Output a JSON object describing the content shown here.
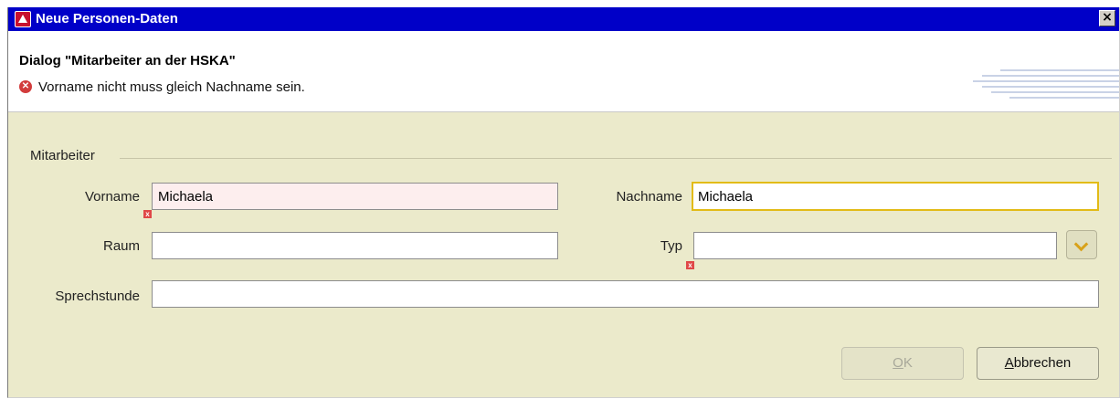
{
  "window": {
    "title": "Neue Personen-Daten"
  },
  "header": {
    "dialog_title": "Dialog \"Mitarbeiter an der HSKA\"",
    "error_message": "Vorname nicht muss gleich Nachname sein."
  },
  "form": {
    "section_label": "Mitarbeiter",
    "vorname": {
      "label": "Vorname",
      "value": "Michaela"
    },
    "nachname": {
      "label": "Nachname",
      "value": "Michaela"
    },
    "raum": {
      "label": "Raum",
      "value": ""
    },
    "typ": {
      "label": "Typ",
      "value": ""
    },
    "sprechstunde": {
      "label": "Sprechstunde",
      "value": ""
    }
  },
  "buttons": {
    "ok_mnemonic": "O",
    "ok_rest": "K",
    "cancel_mnemonic": "A",
    "cancel_rest": "bbrechen"
  },
  "icons": {
    "app": "app-icon",
    "close": "close-icon",
    "error": "error-icon",
    "field_error": "field-error-icon",
    "dropdown": "chevron-down-icon"
  },
  "colors": {
    "titlebar": "#0000c8",
    "dialog_background": "#ebeacb",
    "error_field_background": "#fdeeee",
    "focus_border": "#e2bb17"
  }
}
